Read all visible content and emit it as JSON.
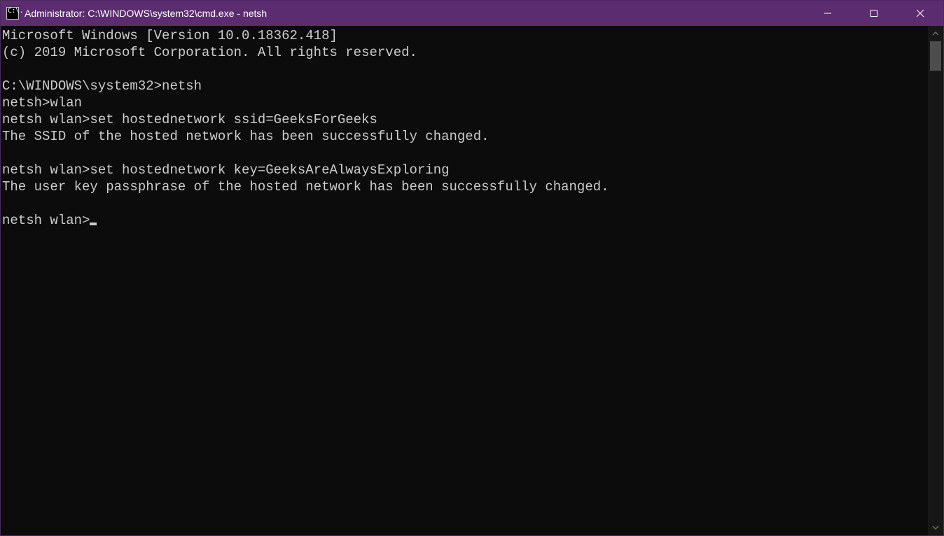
{
  "window": {
    "title": "Administrator: C:\\WINDOWS\\system32\\cmd.exe - netsh",
    "icon_label": "C:\\."
  },
  "terminal": {
    "lines": [
      "Microsoft Windows [Version 10.0.18362.418]",
      "(c) 2019 Microsoft Corporation. All rights reserved.",
      "",
      "C:\\WINDOWS\\system32>netsh",
      "netsh>wlan",
      "netsh wlan>set hostednetwork ssid=GeeksForGeeks",
      "The SSID of the hosted network has been successfully changed.",
      "",
      "netsh wlan>set hostednetwork key=GeeksAreAlwaysExploring",
      "The user key passphrase of the hosted network has been successfully changed.",
      "",
      "netsh wlan>"
    ]
  }
}
